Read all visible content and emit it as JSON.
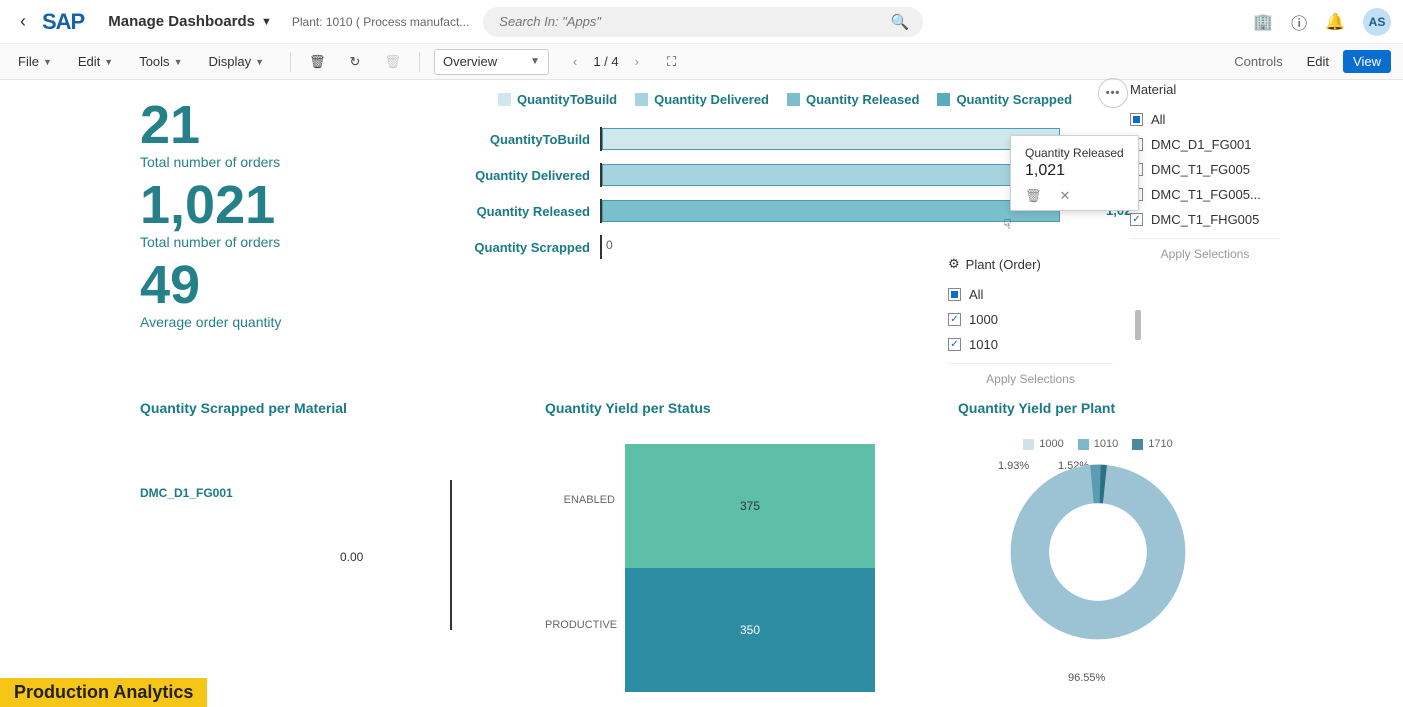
{
  "header": {
    "title": "Manage Dashboards",
    "subtitle": "Plant: 1010 ( Process manufact...",
    "search_placeholder": "Search In: \"Apps\"",
    "avatar": "AS"
  },
  "toolbar": {
    "file": "File",
    "edit": "Edit",
    "tools": "Tools",
    "display": "Display",
    "dropdown": "Overview",
    "pager": "1 / 4",
    "controls": "Controls",
    "edit_btn": "Edit",
    "view_btn": "View"
  },
  "kpi": [
    {
      "val": "21",
      "lbl": "Total number of orders"
    },
    {
      "val": "1,021",
      "lbl": "Total number of orders"
    },
    {
      "val": "49",
      "lbl": "Average order quantity"
    }
  ],
  "chart_data": [
    {
      "type": "bar",
      "orientation": "horizontal",
      "title": "",
      "legend": [
        "QuantityToBuild",
        "Quantity Delivered",
        "Quantity Released",
        "Quantity Scrapped"
      ],
      "categories": [
        "QuantityToBuild",
        "Quantity Delivered",
        "Quantity Released",
        "Quantity Scrapped"
      ],
      "values": [
        1021,
        1021,
        1021,
        0
      ],
      "colors": [
        "#cfe8ee",
        "#a6d3dd",
        "#7bbfcc",
        "#5aacbc"
      ],
      "xlim": [
        0,
        1100
      ]
    },
    {
      "type": "bar",
      "title": "Quantity Scrapped per Material",
      "categories": [
        "DMC_D1_FG001"
      ],
      "values": [
        0.0
      ],
      "xlabel": "",
      "ylabel": ""
    },
    {
      "type": "bar",
      "orientation": "stacked",
      "title": "Quantity Yield per Status",
      "categories": [
        "ENABLED",
        "PRODUCTIVE"
      ],
      "values": [
        375,
        350
      ],
      "colors": [
        "#5ebfa9",
        "#2d8da3"
      ]
    },
    {
      "type": "pie",
      "subtype": "donut",
      "title": "Quantity Yield per Plant",
      "series": [
        {
          "name": "1000",
          "value": 1.93
        },
        {
          "name": "1010",
          "value": 1.52
        },
        {
          "name": "1710",
          "value": 96.55
        }
      ],
      "colors": [
        "#cfe1e9",
        "#7fb6cb",
        "#4a8aa1"
      ],
      "labels": [
        "1.93%",
        "1.52%",
        "96.55%"
      ]
    }
  ],
  "tooltip": {
    "label": "Quantity Released",
    "value": "1,021"
  },
  "filters": {
    "material": {
      "title": "Material",
      "opts": [
        {
          "label": "All",
          "state": "indeterminate"
        },
        {
          "label": "DMC_D1_FG001",
          "state": ""
        },
        {
          "label": "DMC_T1_FG005",
          "state": ""
        },
        {
          "label": "DMC_T1_FG005...",
          "state": ""
        },
        {
          "label": "DMC_T1_FHG005",
          "state": "checked"
        }
      ],
      "apply": "Apply Selections"
    },
    "plant": {
      "title": "Plant (Order)",
      "opts": [
        {
          "label": "All",
          "state": "indeterminate"
        },
        {
          "label": "1000",
          "state": "checked"
        },
        {
          "label": "1010",
          "state": "checked"
        }
      ],
      "apply": "Apply Selections"
    }
  },
  "scrap": {
    "label": "DMC_D1_FG001",
    "val": "0.00"
  },
  "yield_status": {
    "rows": [
      {
        "label": "ENABLED",
        "val": "375"
      },
      {
        "label": "PRODUCTIVE",
        "val": "350"
      }
    ]
  },
  "donut": {
    "legend": [
      "1000",
      "1010",
      "1710"
    ],
    "pct": [
      "1.93%",
      "1.52%",
      "96.55%"
    ]
  },
  "chart_titles": {
    "scrap": "Quantity Scrapped per Material",
    "yield_status": "Quantity Yield per Status",
    "yield_plant": "Quantity Yield per Plant"
  },
  "footer": "Production Analytics"
}
